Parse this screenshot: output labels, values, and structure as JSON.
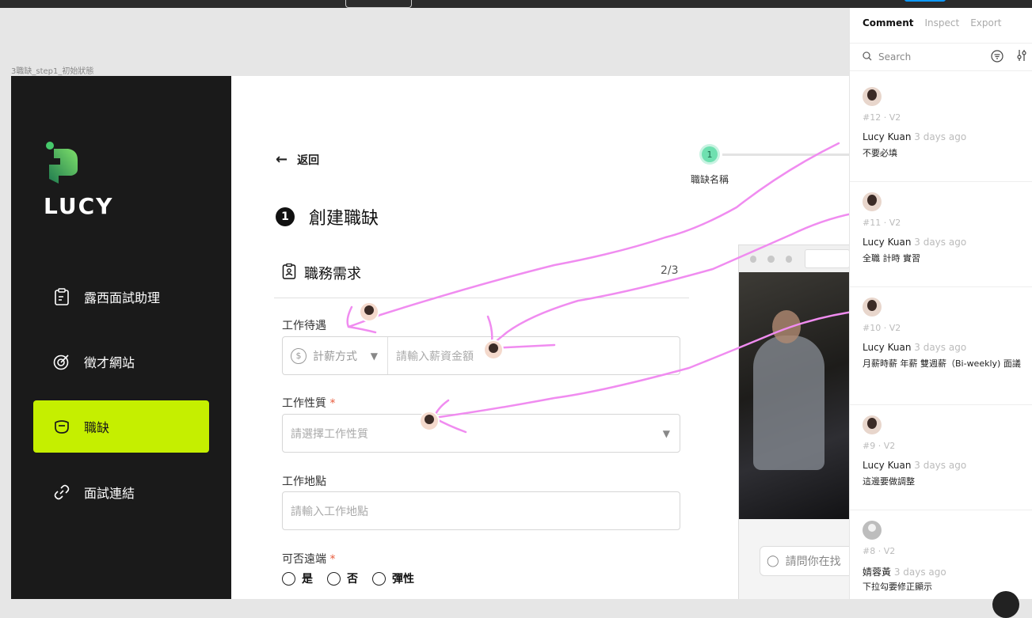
{
  "frame_label": "3職缺_step1_初始狀態",
  "brand": {
    "name": "LUCY"
  },
  "sidebar": {
    "items": [
      {
        "label": "露西面試助理",
        "icon": "clipboard-icon"
      },
      {
        "label": "徵才網站",
        "icon": "target-icon"
      },
      {
        "label": "職缺",
        "icon": "job-icon",
        "active": true
      },
      {
        "label": "面試連結",
        "icon": "link-icon"
      }
    ]
  },
  "main": {
    "back_label": "返回",
    "step": {
      "number": "1",
      "label": "職缺名稱"
    },
    "title_number": "❶",
    "title": "創建職缺",
    "section_title": "職務需求",
    "section_count": "2/3",
    "fields": {
      "salary": {
        "label": "工作待遇",
        "method_placeholder": "計薪方式",
        "amount_placeholder": "請輸入薪資金額"
      },
      "job_type": {
        "label": "工作性質",
        "placeholder": "請選擇工作性質"
      },
      "location": {
        "label": "工作地點",
        "placeholder": "請輸入工作地點"
      },
      "remote": {
        "label": "可否遠端",
        "options": [
          "是",
          "否",
          "彈性"
        ]
      }
    },
    "preview": {
      "ask_placeholder": "請問你在找"
    }
  },
  "panel": {
    "tabs": [
      "Comment",
      "Inspect",
      "Export"
    ],
    "active_tab": "Comment",
    "search_placeholder": "Search",
    "comments": [
      {
        "id": "#12 · V2",
        "author": "Lucy Kuan",
        "time": "3 days ago",
        "text": "不要必填"
      },
      {
        "id": "#11 · V2",
        "author": "Lucy Kuan",
        "time": "3 days ago",
        "text": "全職 計時 實習"
      },
      {
        "id": "#10 · V2",
        "author": "Lucy Kuan",
        "time": "3 days ago",
        "text": "月薪時薪 年薪 雙週薪（Bi-weekly) 面議"
      },
      {
        "id": "#9 · V2",
        "author": "Lucy Kuan",
        "time": "3 days ago",
        "text": "這邊要做調整"
      },
      {
        "id": "#8 · V2",
        "author": "婧蓉黃",
        "time": "3 days ago",
        "text": "下拉勾要修正顯示"
      }
    ]
  },
  "colors": {
    "accent": "#c5ef00",
    "sidebar": "#1a1a1a",
    "annotation": "#f08cf0",
    "step": "#6fe0b0"
  }
}
